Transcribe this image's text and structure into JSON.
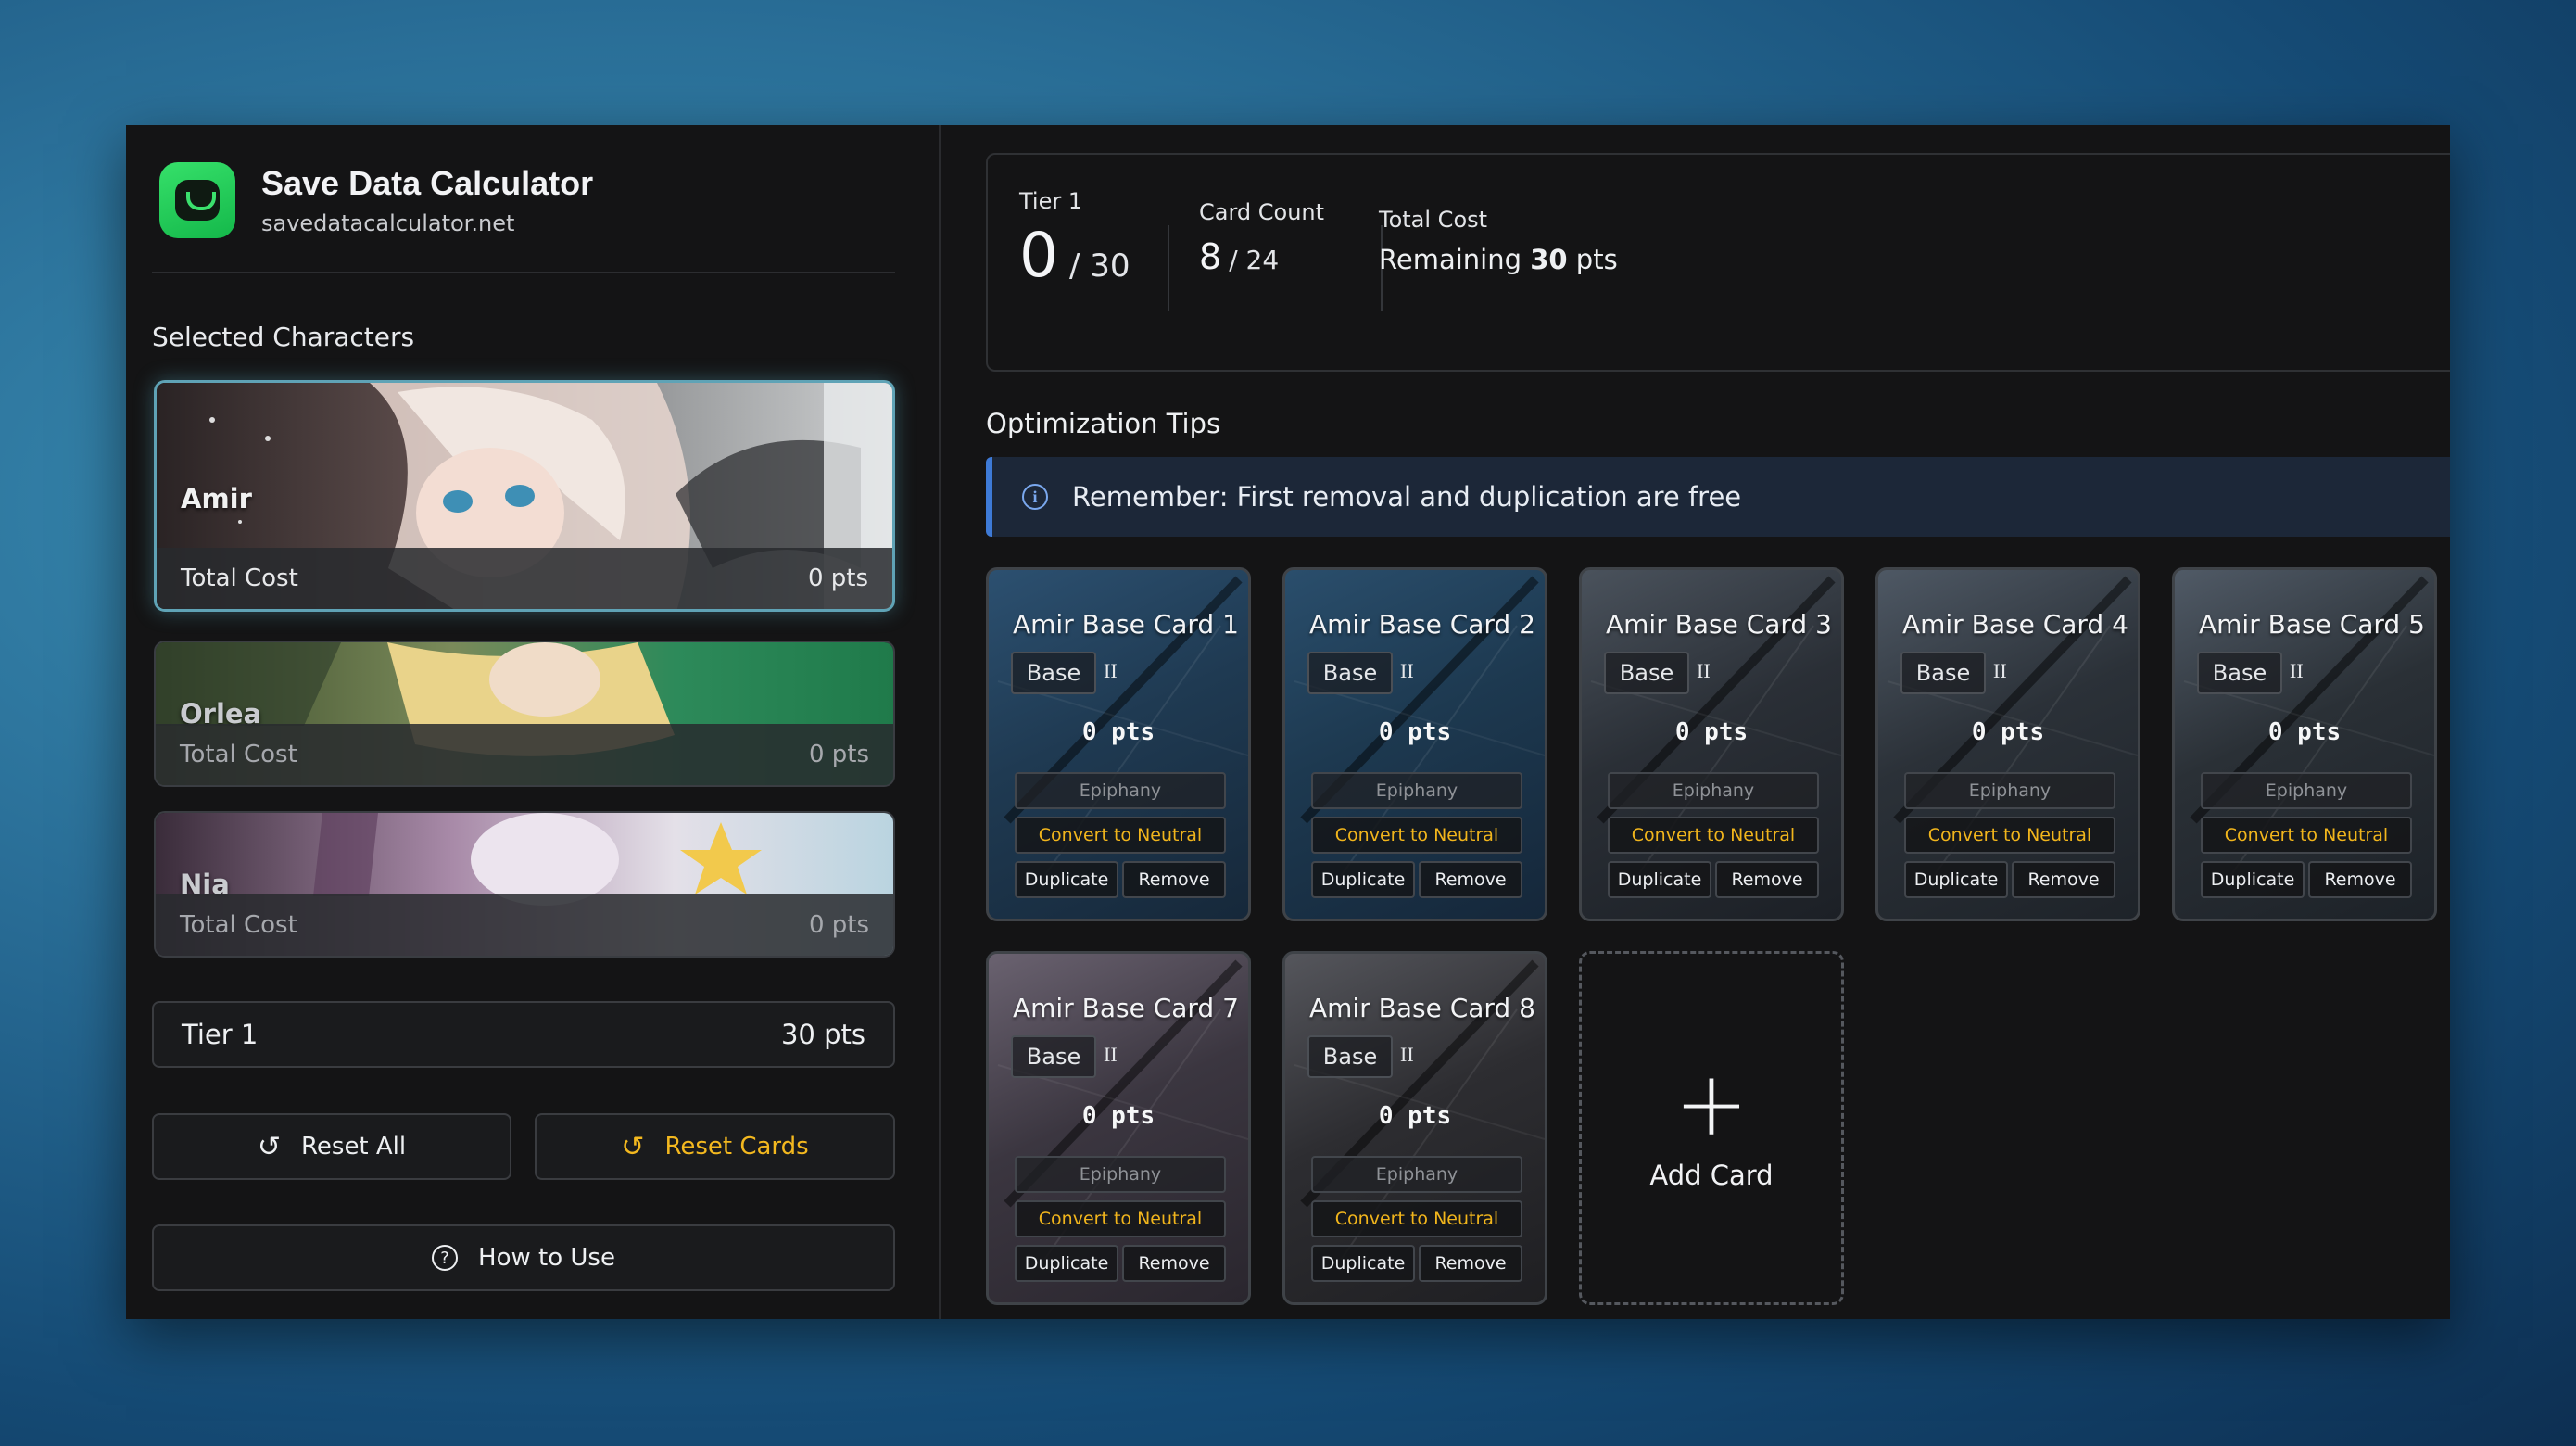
{
  "brand": {
    "title": "Save Data Calculator",
    "url": "savedatacalculator.net"
  },
  "sidebar": {
    "section_title": "Selected Characters",
    "characters": [
      {
        "name": "Amir",
        "cost_label": "Total Cost",
        "cost_value": "0 pts"
      },
      {
        "name": "Orlea",
        "cost_label": "Total Cost",
        "cost_value": "0 pts"
      },
      {
        "name": "Nia",
        "cost_label": "Total Cost",
        "cost_value": "0 pts"
      }
    ],
    "tier": {
      "label": "Tier 1",
      "value": "30 pts"
    },
    "reset_all": "Reset All",
    "reset_cards": "Reset Cards",
    "how_to_use": "How to Use"
  },
  "stats": {
    "tier_label": "Tier 1",
    "tier_value": "0",
    "tier_max": "/ 30",
    "count_label": "Card Count",
    "count_value": "8",
    "count_max": "/ 24",
    "cost_label": "Total Cost",
    "remaining_prefix": "Remaining",
    "remaining_value": "30",
    "remaining_suffix": "pts"
  },
  "tips": {
    "title": "Optimization Tips",
    "message": "Remember: First removal and duplication are free"
  },
  "card_labels": {
    "tag": "Base",
    "roman": "II",
    "pts": "0 pts",
    "epiphany": "Epiphany",
    "convert": "Convert to Neutral",
    "duplicate": "Duplicate",
    "remove": "Remove"
  },
  "cards": [
    {
      "title": "Amir Base Card 1"
    },
    {
      "title": "Amir Base Card 2"
    },
    {
      "title": "Amir Base Card 3"
    },
    {
      "title": "Amir Base Card 4"
    },
    {
      "title": "Amir Base Card 5"
    },
    {
      "title": "Amir Base Card 7"
    },
    {
      "title": "Amir Base Card 8"
    }
  ],
  "add_card": {
    "label": "Add Card"
  },
  "colors": {
    "accent_gold": "#f3b81f",
    "tip_blue": "#3e7ad6",
    "logo_green": "#22c55e"
  }
}
